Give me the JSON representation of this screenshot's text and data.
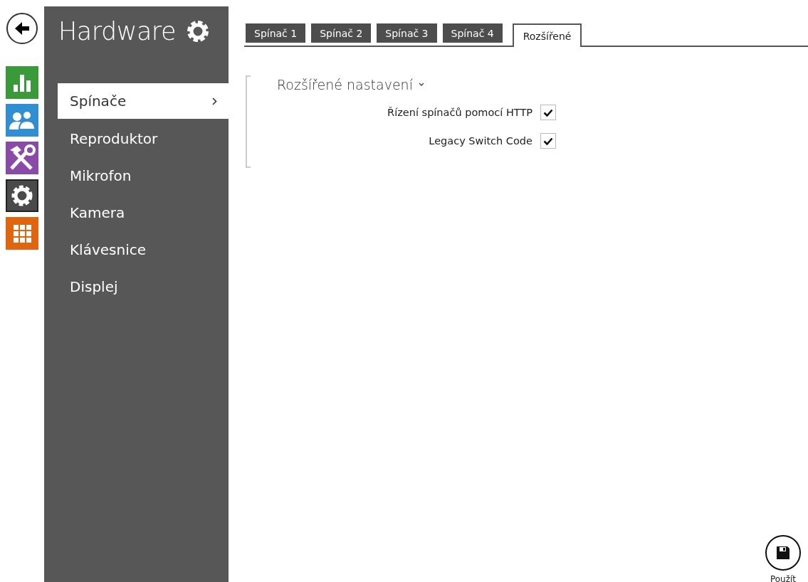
{
  "app_nav": [
    {
      "kind": "dashboard",
      "selected": false
    },
    {
      "kind": "users",
      "selected": false
    },
    {
      "kind": "services",
      "selected": false
    },
    {
      "kind": "hardware",
      "selected": true
    },
    {
      "kind": "system",
      "selected": false
    }
  ],
  "sidebar": {
    "title": "Hardware",
    "items": [
      {
        "label": "Spínače",
        "selected": true
      },
      {
        "label": "Reproduktor",
        "selected": false
      },
      {
        "label": "Mikrofon",
        "selected": false
      },
      {
        "label": "Kamera",
        "selected": false
      },
      {
        "label": "Klávesnice",
        "selected": false
      },
      {
        "label": "Displej",
        "selected": false
      }
    ]
  },
  "tabs": [
    {
      "label": "Spínač 1",
      "selected": false
    },
    {
      "label": "Spínač 2",
      "selected": false
    },
    {
      "label": "Spínač 3",
      "selected": false
    },
    {
      "label": "Spínač 4",
      "selected": false
    },
    {
      "label": "Rozšířené",
      "selected": true
    }
  ],
  "section": {
    "title": "Rozšířené nastavení",
    "expanded": true,
    "settings": [
      {
        "label": "Řízení spínačů pomocí HTTP",
        "checked": true
      },
      {
        "label": "Legacy Switch Code",
        "checked": true
      }
    ]
  },
  "apply_button": {
    "label": "Použít"
  }
}
